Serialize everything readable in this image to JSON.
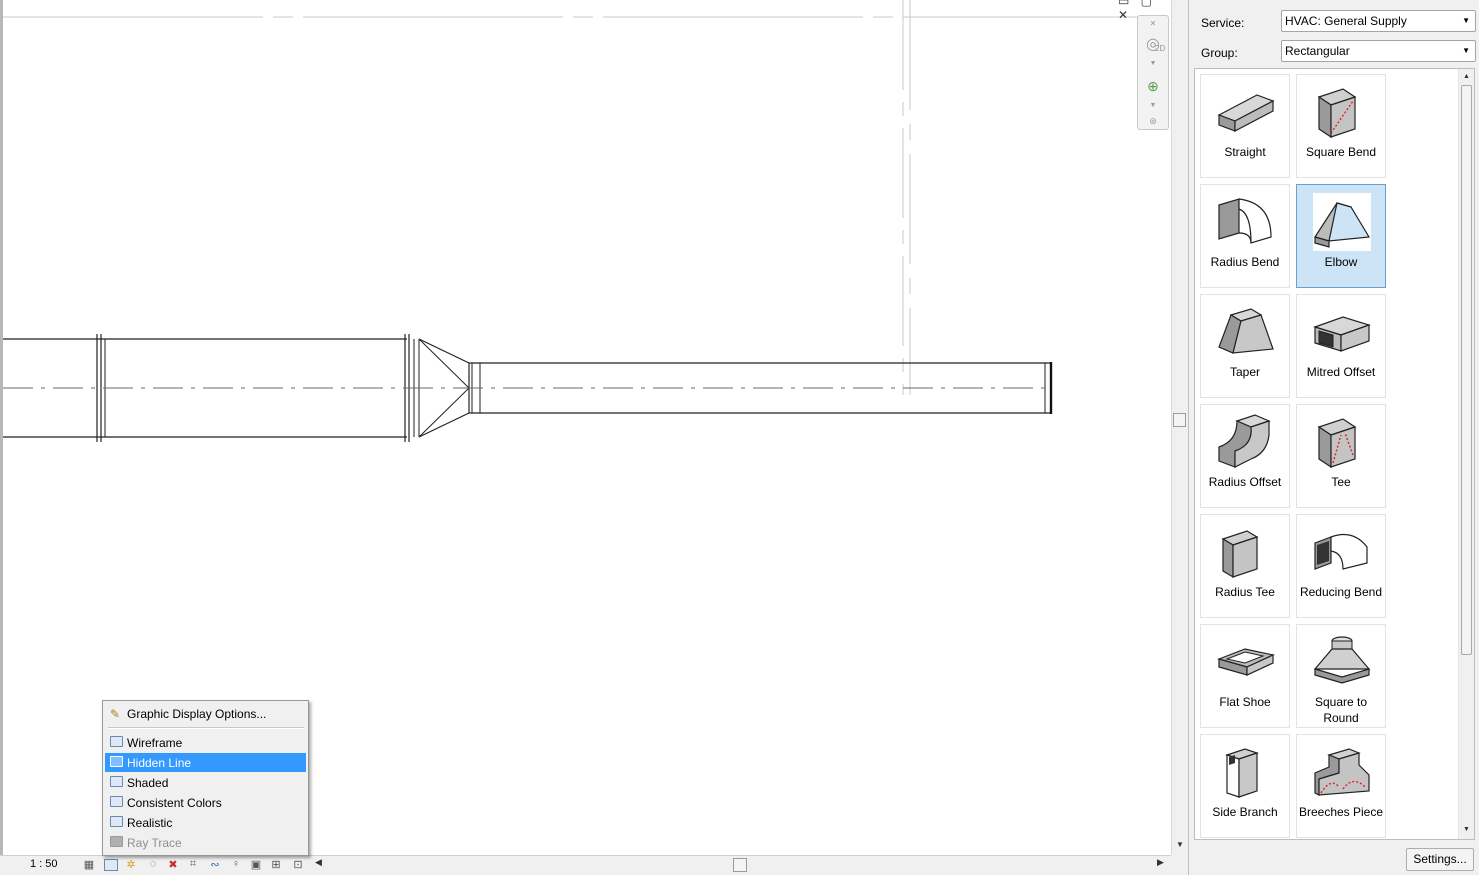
{
  "canvas": {
    "window_controls": "▭ ▢ ✕",
    "nav_bar": {
      "zoom_2d_label": "2D"
    }
  },
  "status_bar": {
    "scale": "1 : 50",
    "icons": [
      "detail-level-icon",
      "visual-style-icon",
      "sun-path-icon",
      "shadows-icon",
      "crop-region-icon",
      "show-crop-icon",
      "temporary-hide-icon",
      "reveal-hidden-icon",
      "lock-3d-icon",
      "analytical-model-icon",
      "highlight-displacement-icon",
      "constraints-icon"
    ]
  },
  "visual_style_menu": {
    "graphic_display_options": "Graphic Display Options...",
    "items": [
      {
        "label": "Wireframe",
        "state": "normal"
      },
      {
        "label": "Hidden Line",
        "state": "selected"
      },
      {
        "label": "Shaded",
        "state": "normal"
      },
      {
        "label": "Consistent Colors",
        "state": "normal"
      },
      {
        "label": "Realistic",
        "state": "normal"
      },
      {
        "label": "Ray Trace",
        "state": "disabled"
      }
    ]
  },
  "fittings_panel": {
    "service_label": "Service:",
    "service_value": "HVAC: General Supply",
    "group_label": "Group:",
    "group_value": "Rectangular",
    "tiles": [
      {
        "label": "Straight",
        "icon": "straight-duct-icon"
      },
      {
        "label": "Square Bend",
        "icon": "square-bend-icon"
      },
      {
        "label": "Radius Bend",
        "icon": "radius-bend-icon"
      },
      {
        "label": "Elbow",
        "icon": "elbow-icon",
        "selected": true
      },
      {
        "label": "Taper",
        "icon": "taper-icon"
      },
      {
        "label": "Mitred Offset",
        "icon": "mitred-offset-icon"
      },
      {
        "label": "Radius Offset",
        "icon": "radius-offset-icon"
      },
      {
        "label": "Tee",
        "icon": "tee-icon"
      },
      {
        "label": "Radius Tee",
        "icon": "radius-tee-icon"
      },
      {
        "label": "Reducing Bend",
        "icon": "reducing-bend-icon"
      },
      {
        "label": "Flat Shoe",
        "icon": "flat-shoe-icon"
      },
      {
        "label": "Square to Round",
        "icon": "square-to-round-icon"
      },
      {
        "label": "Side Branch",
        "icon": "side-branch-icon"
      },
      {
        "label": "Breeches Piece",
        "icon": "breeches-piece-icon"
      }
    ],
    "settings_button": "Settings...",
    "colors": {
      "selection": "#cde4f7",
      "menu_highlight": "#3399ff",
      "fitting_marker": "#e02020"
    }
  }
}
